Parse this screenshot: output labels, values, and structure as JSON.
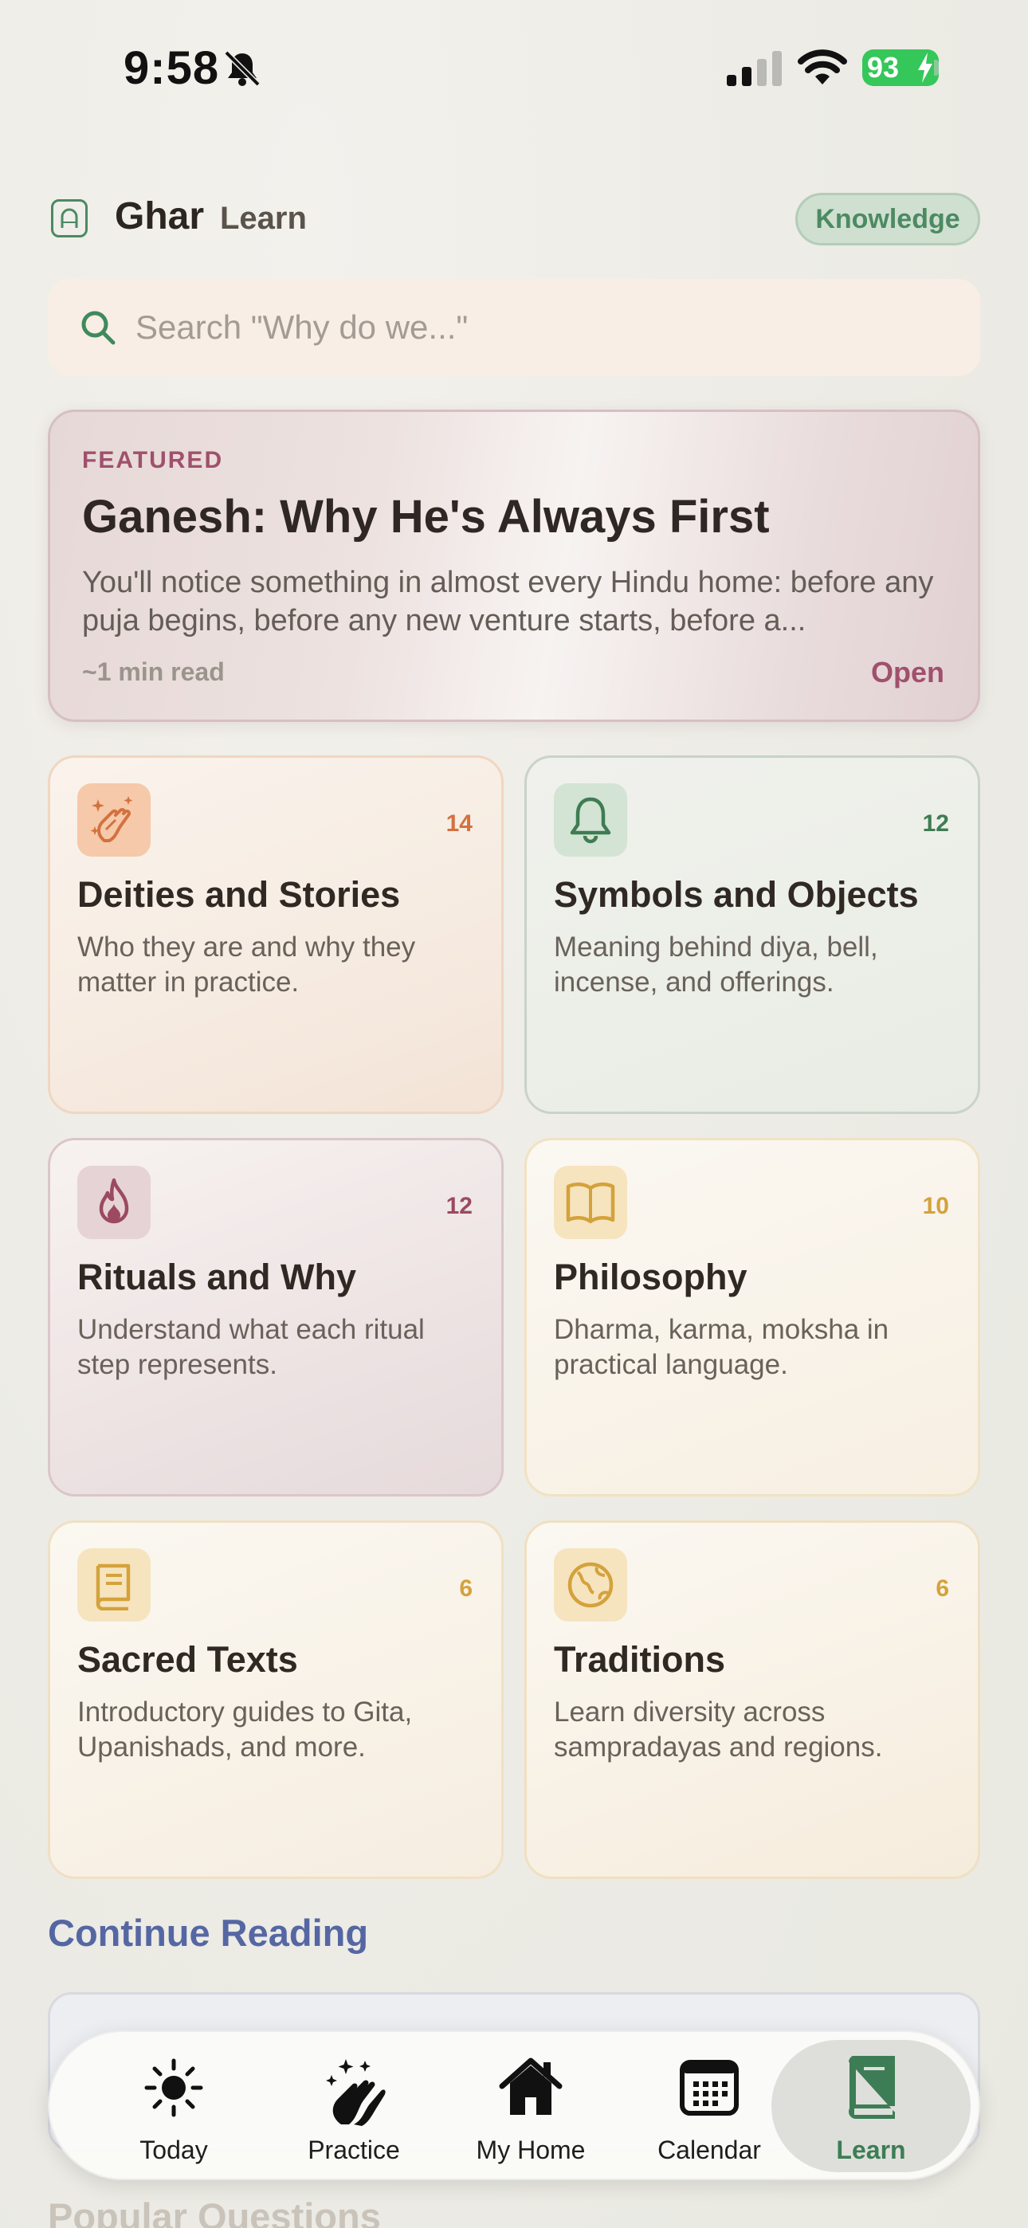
{
  "status_bar": {
    "time": "9:58",
    "battery": "93"
  },
  "header": {
    "brand": "Ghar",
    "page": "Learn",
    "badge": "Knowledge"
  },
  "search": {
    "placeholder": "Search \"Why do we...\""
  },
  "featured": {
    "kicker": "FEATURED",
    "title": "Ganesh: Why He's Always First",
    "excerpt": "You'll notice something in almost every Hindu home: before any puja begins, before any new venture starts, before a...",
    "meta": "~1 min read",
    "action": "Open"
  },
  "categories": [
    {
      "title": "Deities and Stories",
      "description": "Who they are and why they matter in practice.",
      "count": "14",
      "icon": "namaste-sparkle-icon",
      "accent": "#d3713f"
    },
    {
      "title": "Symbols and Objects",
      "description": "Meaning behind diya, bell, incense, and offerings.",
      "count": "12",
      "icon": "bell-icon",
      "accent": "#3e7c52"
    },
    {
      "title": "Rituals and Why",
      "description": "Understand what each ritual step represents.",
      "count": "12",
      "icon": "flame-icon",
      "accent": "#9b4a62"
    },
    {
      "title": "Philosophy",
      "description": "Dharma, karma, moksha in practical language.",
      "count": "10",
      "icon": "open-book-icon",
      "accent": "#d4a23c"
    },
    {
      "title": "Sacred Texts",
      "description": "Introductory guides to Gita, Upanishads, and more.",
      "count": "6",
      "icon": "closed-book-icon",
      "accent": "#d4a23c"
    },
    {
      "title": "Traditions",
      "description": "Learn diversity across sampradayas and regions.",
      "count": "6",
      "icon": "globe-icon",
      "accent": "#d4a23c"
    }
  ],
  "sections": {
    "continue_reading": "Continue Reading",
    "popular_questions": "Popular Questions"
  },
  "tabbar": {
    "items": [
      {
        "label": "Today",
        "icon": "sun-icon"
      },
      {
        "label": "Practice",
        "icon": "hands-sparkle-icon"
      },
      {
        "label": "My Home",
        "icon": "house-icon"
      },
      {
        "label": "Calendar",
        "icon": "calendar-icon"
      },
      {
        "label": "Learn",
        "icon": "book-icon",
        "selected": true
      }
    ]
  }
}
